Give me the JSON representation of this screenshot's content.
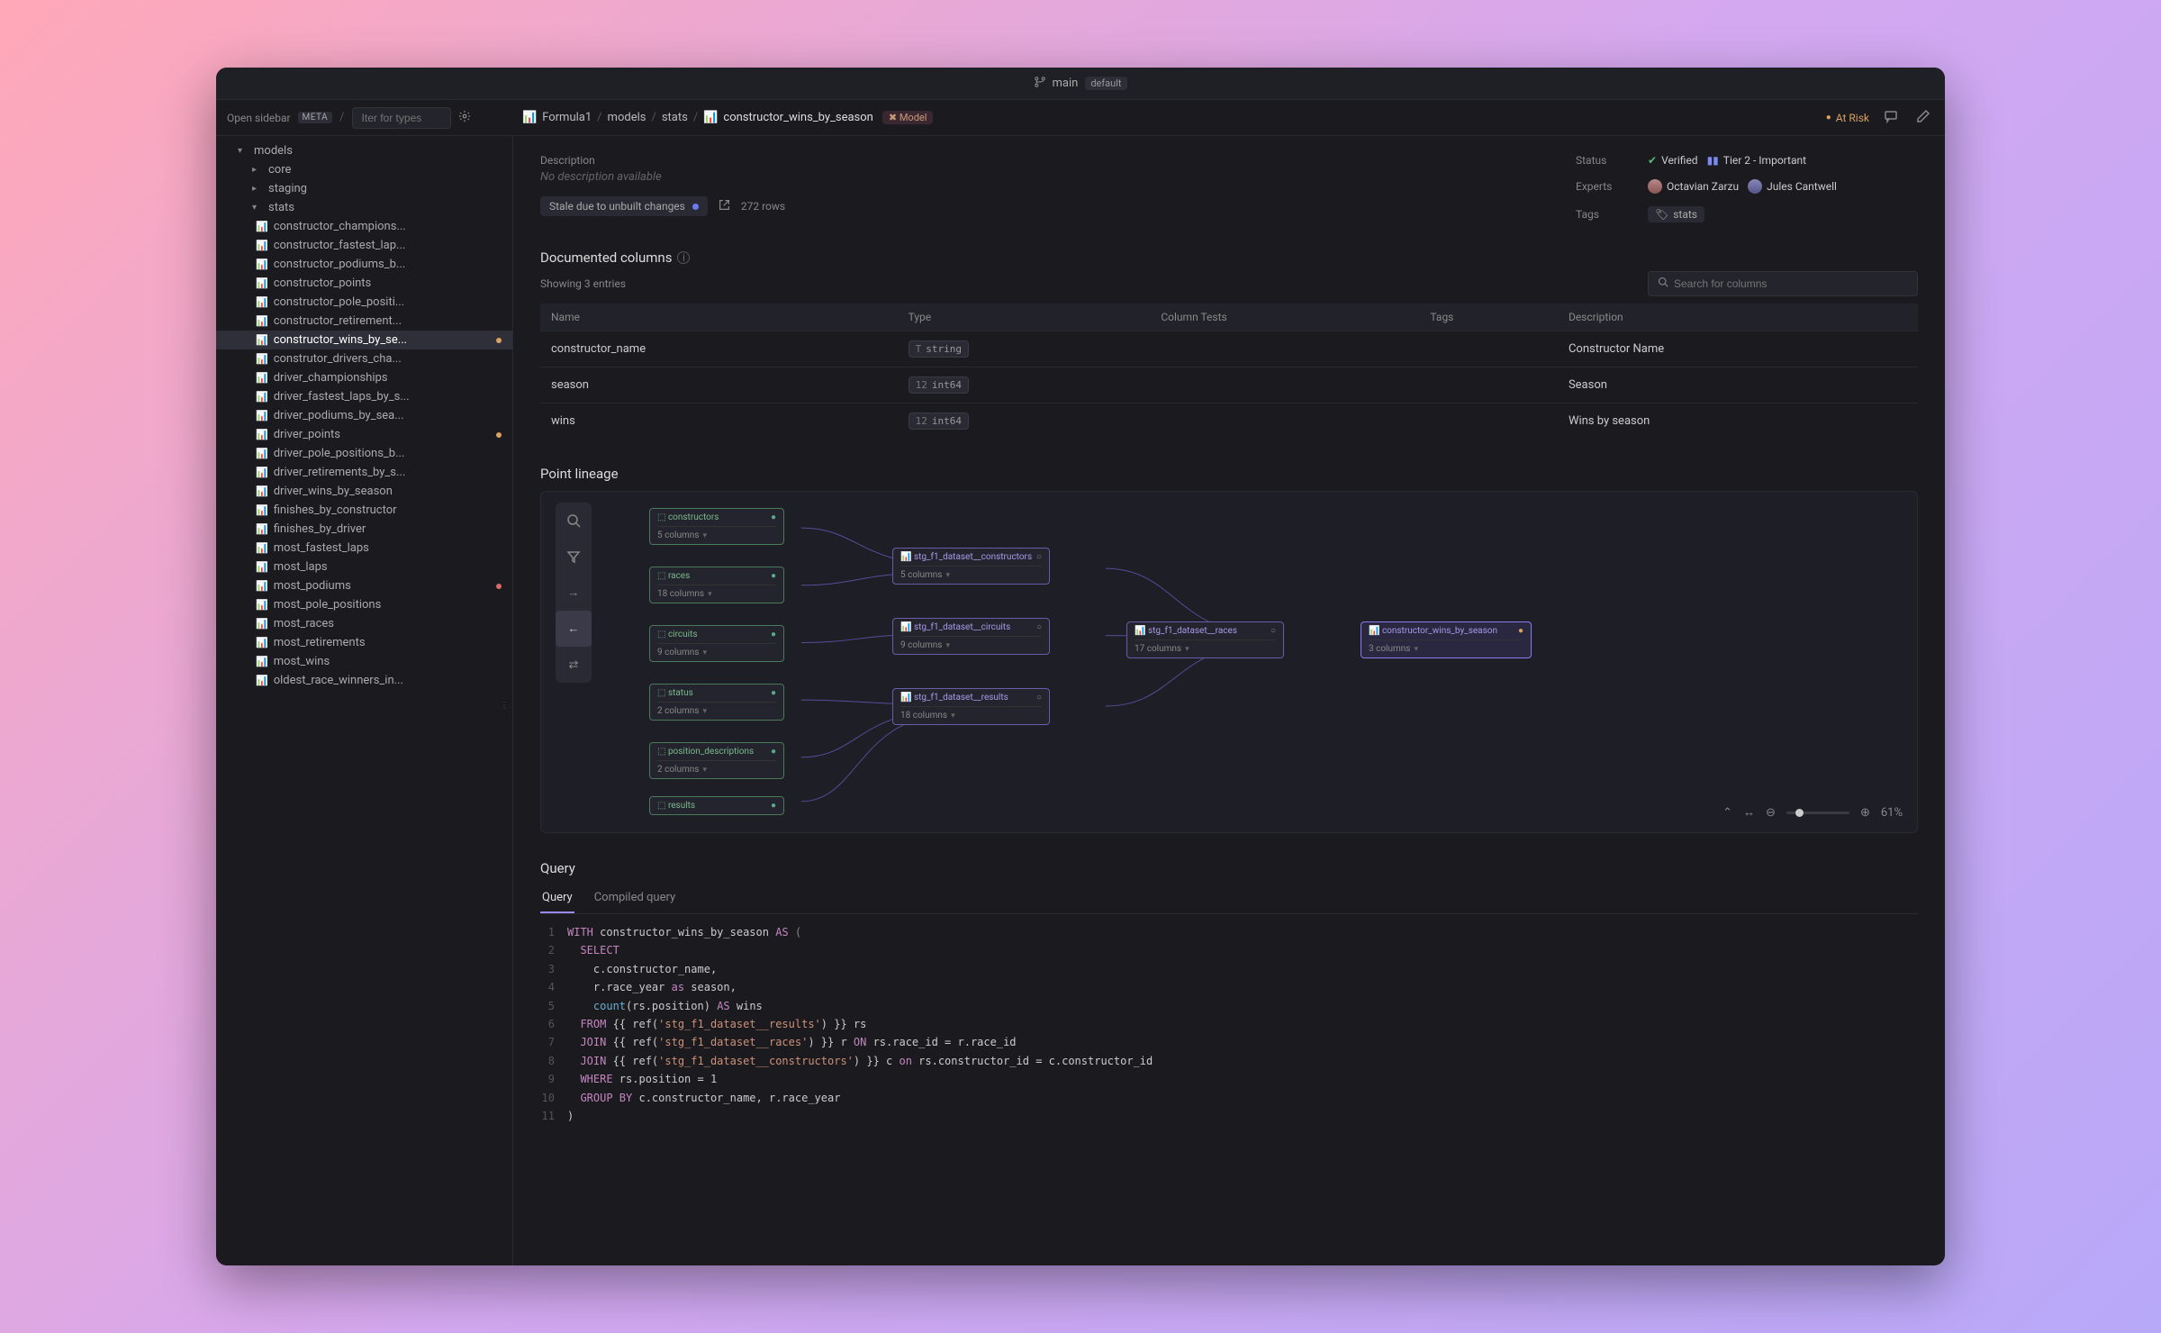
{
  "titlebar": {
    "branch": "main",
    "badge": "default"
  },
  "toolbar": {
    "open_sidebar": "Open sidebar",
    "meta": "META",
    "filter_placeholder": "Iter for types"
  },
  "breadcrumb": {
    "items": [
      "Formula1",
      "models",
      "stats",
      "constructor_wins_by_season"
    ],
    "model_badge": "Model"
  },
  "at_risk": "At Risk",
  "sidebar": {
    "models_label": "models",
    "folders": [
      "core",
      "staging",
      "stats"
    ],
    "items": [
      {
        "label": "constructor_champions...",
        "dot": null
      },
      {
        "label": "constructor_fastest_lap...",
        "dot": null
      },
      {
        "label": "constructor_podiums_b...",
        "dot": null
      },
      {
        "label": "constructor_points",
        "dot": null
      },
      {
        "label": "constructor_pole_positi...",
        "dot": null
      },
      {
        "label": "constructor_retirement...",
        "dot": null
      },
      {
        "label": "constructor_wins_by_se...",
        "dot": "orange",
        "selected": true
      },
      {
        "label": "construtor_drivers_cha...",
        "dot": null
      },
      {
        "label": "driver_championships",
        "dot": null
      },
      {
        "label": "driver_fastest_laps_by_s...",
        "dot": null
      },
      {
        "label": "driver_podiums_by_sea...",
        "dot": null
      },
      {
        "label": "driver_points",
        "dot": "orange"
      },
      {
        "label": "driver_pole_positions_b...",
        "dot": null
      },
      {
        "label": "driver_retirements_by_s...",
        "dot": null
      },
      {
        "label": "driver_wins_by_season",
        "dot": null
      },
      {
        "label": "finishes_by_constructor",
        "dot": null
      },
      {
        "label": "finishes_by_driver",
        "dot": null
      },
      {
        "label": "most_fastest_laps",
        "dot": null
      },
      {
        "label": "most_laps",
        "dot": null
      },
      {
        "label": "most_podiums",
        "dot": "red"
      },
      {
        "label": "most_pole_positions",
        "dot": null
      },
      {
        "label": "most_races",
        "dot": null
      },
      {
        "label": "most_retirements",
        "dot": null
      },
      {
        "label": "most_wins",
        "dot": null
      },
      {
        "label": "oldest_race_winners_in...",
        "dot": null
      }
    ]
  },
  "description": {
    "label": "Description",
    "text": "No description available",
    "stale": "Stale due to unbuilt changes",
    "rows": "272 rows"
  },
  "meta": {
    "status_label": "Status",
    "verified": "Verified",
    "tier": "Tier 2 - Important",
    "experts_label": "Experts",
    "experts": [
      "Octavian Zarzu",
      "Jules Cantwell"
    ],
    "tags_label": "Tags",
    "tags": [
      "stats"
    ]
  },
  "columns": {
    "title": "Documented columns",
    "showing": "Showing 3 entries",
    "search_placeholder": "Search for columns",
    "headers": [
      "Name",
      "Type",
      "Column Tests",
      "Tags",
      "Description"
    ],
    "rows": [
      {
        "name": "constructor_name",
        "type": "string",
        "desc": "Constructor Name"
      },
      {
        "name": "season",
        "type": "int64",
        "desc": "Season"
      },
      {
        "name": "wins",
        "type": "int64",
        "desc": "Wins by season"
      }
    ]
  },
  "lineage": {
    "title": "Point lineage",
    "zoom": "61%",
    "nodes": {
      "constructors": "constructors",
      "constructors_sub": "5 columns",
      "races": "races",
      "races_sub": "18 columns",
      "circuits": "circuits",
      "circuits_sub": "9 columns",
      "status": "status",
      "status_sub": "2 columns",
      "position_descriptions": "position_descriptions",
      "position_descriptions_sub": "2 columns",
      "results": "results",
      "stg_constructors": "stg_f1_dataset__constructors",
      "stg_constructors_sub": "5 columns",
      "stg_circuits": "stg_f1_dataset__circuits",
      "stg_circuits_sub": "9 columns",
      "stg_results": "stg_f1_dataset__results",
      "stg_results_sub": "18 columns",
      "stg_races": "stg_f1_dataset__races",
      "stg_races_sub": "17 columns",
      "target": "constructor_wins_by_season",
      "target_sub": "3 columns"
    }
  },
  "query": {
    "title": "Query",
    "tabs": [
      "Query",
      "Compiled query"
    ],
    "lines": [
      {
        "n": "1",
        "tokens": [
          [
            "kw",
            "WITH"
          ],
          [
            "ident",
            " constructor_wins_by_season "
          ],
          [
            "kw",
            "AS"
          ],
          [
            "op",
            " ("
          ]
        ]
      },
      {
        "n": "2",
        "tokens": [
          [
            "ident",
            "  "
          ],
          [
            "kw",
            "SELECT"
          ]
        ]
      },
      {
        "n": "3",
        "tokens": [
          [
            "ident",
            "    c.constructor_name,"
          ]
        ]
      },
      {
        "n": "4",
        "tokens": [
          [
            "ident",
            "    r.race_year "
          ],
          [
            "kw",
            "as"
          ],
          [
            "ident",
            " season,"
          ]
        ]
      },
      {
        "n": "5",
        "tokens": [
          [
            "ident",
            "    "
          ],
          [
            "fn",
            "count"
          ],
          [
            "ident",
            "(rs.position) "
          ],
          [
            "kw",
            "AS"
          ],
          [
            "ident",
            " wins"
          ]
        ]
      },
      {
        "n": "6",
        "tokens": [
          [
            "ident",
            "  "
          ],
          [
            "kw",
            "FROM"
          ],
          [
            "ident",
            " {{ ref("
          ],
          [
            "str",
            "'stg_f1_dataset__results'"
          ],
          [
            "ident",
            ") }} rs"
          ]
        ]
      },
      {
        "n": "7",
        "tokens": [
          [
            "ident",
            "  "
          ],
          [
            "kw",
            "JOIN"
          ],
          [
            "ident",
            " {{ ref("
          ],
          [
            "str",
            "'stg_f1_dataset__races'"
          ],
          [
            "ident",
            ") }} r "
          ],
          [
            "kw",
            "ON"
          ],
          [
            "ident",
            " rs.race_id = r.race_id"
          ]
        ]
      },
      {
        "n": "8",
        "tokens": [
          [
            "ident",
            "  "
          ],
          [
            "kw",
            "JOIN"
          ],
          [
            "ident",
            " {{ ref("
          ],
          [
            "str",
            "'stg_f1_dataset__constructors'"
          ],
          [
            "ident",
            ") }} c "
          ],
          [
            "kw",
            "on"
          ],
          [
            "ident",
            " rs.constructor_id = c.constructor_id"
          ]
        ]
      },
      {
        "n": "9",
        "tokens": [
          [
            "ident",
            "  "
          ],
          [
            "kw",
            "WHERE"
          ],
          [
            "ident",
            " rs.position = 1"
          ]
        ]
      },
      {
        "n": "10",
        "tokens": [
          [
            "ident",
            "  "
          ],
          [
            "kw",
            "GROUP BY"
          ],
          [
            "ident",
            " c.constructor_name, r.race_year"
          ]
        ]
      },
      {
        "n": "11",
        "tokens": [
          [
            "ident",
            ")"
          ]
        ]
      }
    ]
  }
}
